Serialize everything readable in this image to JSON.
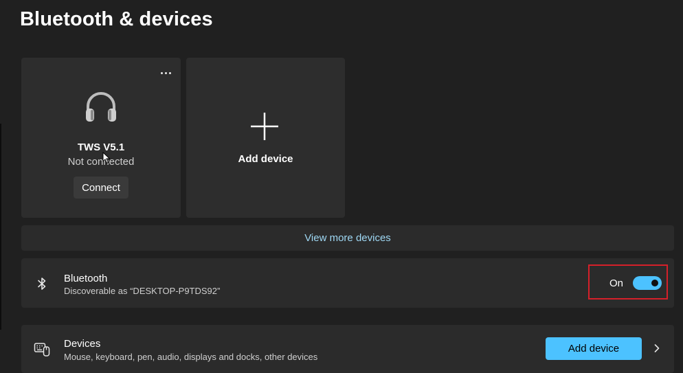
{
  "page": {
    "title": "Bluetooth & devices"
  },
  "devices": [
    {
      "name": "TWS V5.1",
      "status": "Not connected",
      "action_label": "Connect",
      "icon": "headphones-icon"
    }
  ],
  "add_card": {
    "label": "Add device",
    "icon": "plus-icon"
  },
  "view_more": {
    "label": "View more devices"
  },
  "bluetooth": {
    "title": "Bluetooth",
    "subtitle": "Discoverable as “DESKTOP-P9TDS92”",
    "toggle_label": "On",
    "toggle_on": true,
    "icon": "bluetooth-icon"
  },
  "devices_row": {
    "title": "Devices",
    "subtitle": "Mouse, keyboard, pen, audio, displays and docks, other devices",
    "button_label": "Add device",
    "icon": "devices-icon"
  },
  "colors": {
    "background": "#202020",
    "card": "#2d2d2d",
    "accent": "#4cc2ff",
    "link": "#9fd8f4",
    "highlight": "#d6202a"
  }
}
